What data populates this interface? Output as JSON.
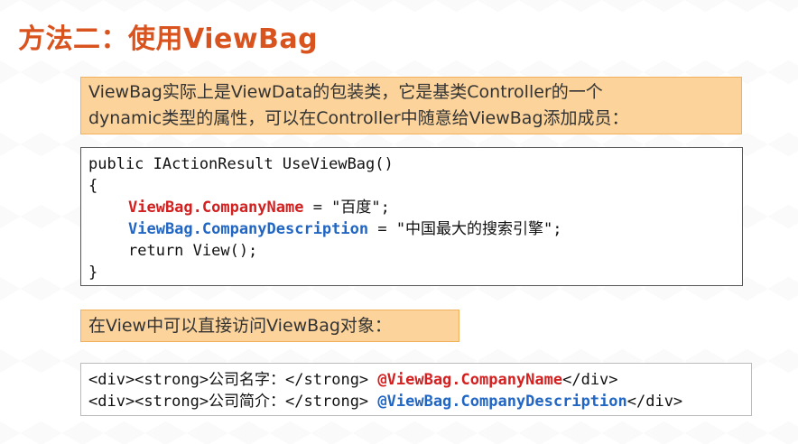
{
  "title": "方法二：使用ViewBag",
  "note1": {
    "line1": "ViewBag实际上是ViewData的包装类，它是基类Controller的一个",
    "line2": "dynamic类型的属性，可以在Controller中随意给ViewBag添加成员："
  },
  "code1": {
    "line1": "public IActionResult UseViewBag()",
    "line2": "{",
    "line3_prop": "ViewBag.CompanyName",
    "line3_rest": " = \"百度\";",
    "line4_prop": "ViewBag.CompanyDescription",
    "line4_rest": " = \"中国最大的搜索引擎\";",
    "line5": "return View();",
    "line6": "}"
  },
  "note2": "在View中可以直接访问ViewBag对象：",
  "code2": {
    "line1_pre": "<div><strong>公司名字：</strong> ",
    "line1_prop": "@ViewBag.CompanyName",
    "line1_post": "</div>",
    "line2_pre": "<div><strong>公司简介：</strong> ",
    "line2_prop": "@ViewBag.CompanyDescription",
    "line2_post": "</div>"
  },
  "colors": {
    "title": "#d9531e",
    "note_bg": "#fbd39b",
    "red_prop": "#d32020",
    "blue_prop": "#2266c4"
  }
}
